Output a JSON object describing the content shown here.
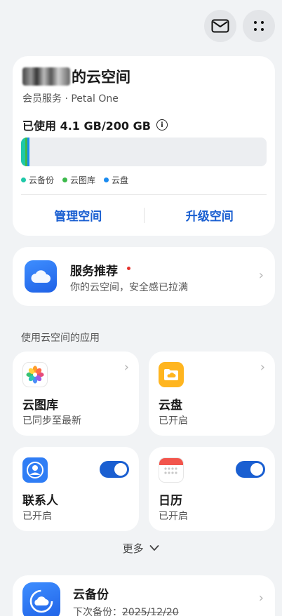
{
  "header": {
    "mail_icon": "mail-icon",
    "more_icon": "more-dots-icon"
  },
  "storage": {
    "owner_suffix": "的云空间",
    "member_line": "会员服务 · Petal One",
    "used_label": "已使用 4.1 GB/200 GB",
    "info_icon": "i",
    "used_fraction": 0.0205,
    "segments": [
      {
        "name": "云备份",
        "color": "#1fc8a8",
        "value": 0.006
      },
      {
        "name": "云图库",
        "color": "#3cb94b",
        "value": 0.006
      },
      {
        "name": "云盘",
        "color": "#1a8bf0",
        "value": 0.006
      }
    ],
    "legend": [
      "云备份",
      "云图库",
      "云盘"
    ],
    "actions": {
      "manage": "管理空间",
      "upgrade": "升级空间"
    }
  },
  "service": {
    "title": "服务推荐",
    "subtitle": "你的云空间，安全感已拉满"
  },
  "apps_section": {
    "title": "使用云空间的应用",
    "tiles": [
      {
        "name": "云图库",
        "status": "已同步至最新",
        "icon": "gallery-icon"
      },
      {
        "name": "云盘",
        "status": "已开启",
        "icon": "drive-icon"
      },
      {
        "name": "联系人",
        "status": "已开启",
        "icon": "contacts-icon",
        "toggle_on": true
      },
      {
        "name": "日历",
        "status": "已开启",
        "icon": "calendar-icon",
        "toggle_on": true
      }
    ],
    "more_label": "更多"
  },
  "backup": {
    "title": "云备份",
    "subtitle_prefix": "下次备份：",
    "subtitle_date": "2025/12/20"
  },
  "colors": {
    "accent": "#1a5fd1",
    "background": "#f1f3f5"
  }
}
